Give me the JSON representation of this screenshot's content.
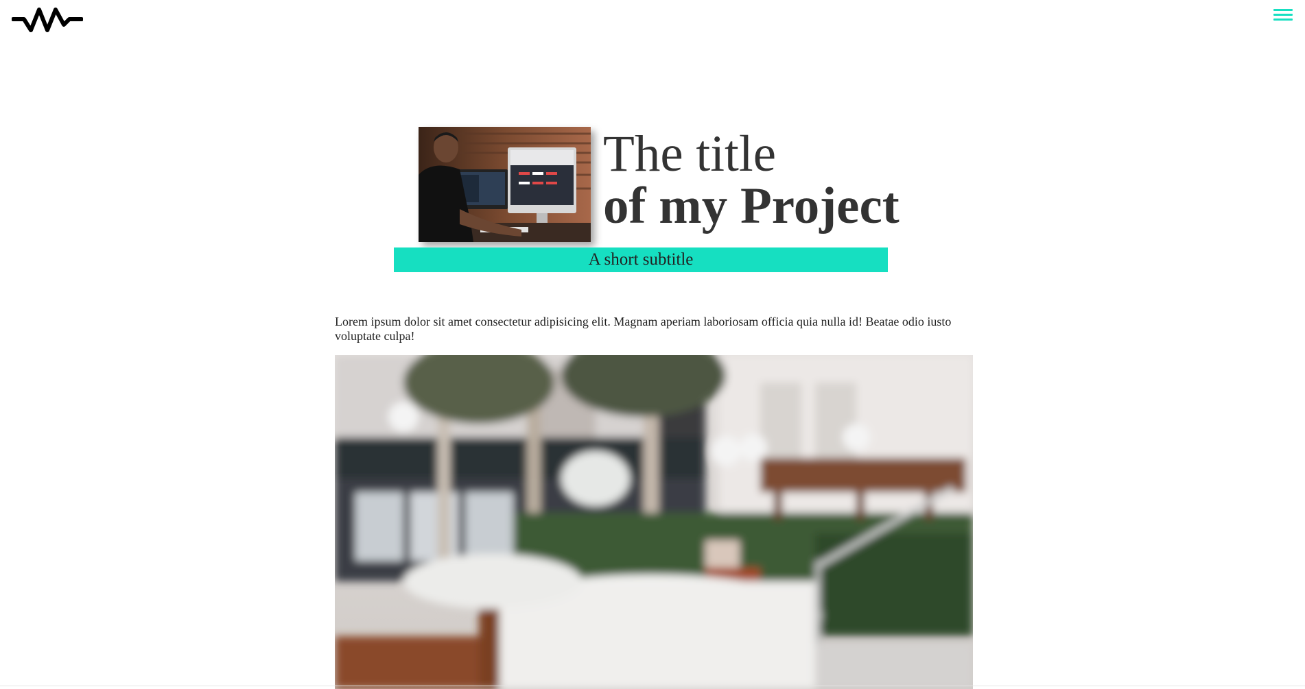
{
  "header": {
    "logo_icon": "zigzag-wave-logo",
    "menu_icon": "hamburger-menu-icon",
    "accent_color": "#16dfc1"
  },
  "hero": {
    "title_line1": "The title",
    "title_line2": "of my Project",
    "subtitle": "A short subtitle",
    "thumbnail_icon": "photo-man-at-computer"
  },
  "content": {
    "intro_text": "Lorem ipsum dolor sit amet consectetur adipisicing elit. Magnam aperiam laboriosam officia quia nulla id! Beatae odio iusto voluptate culpa!",
    "main_image_icon": "photo-blurred-outdoor-plaza"
  }
}
